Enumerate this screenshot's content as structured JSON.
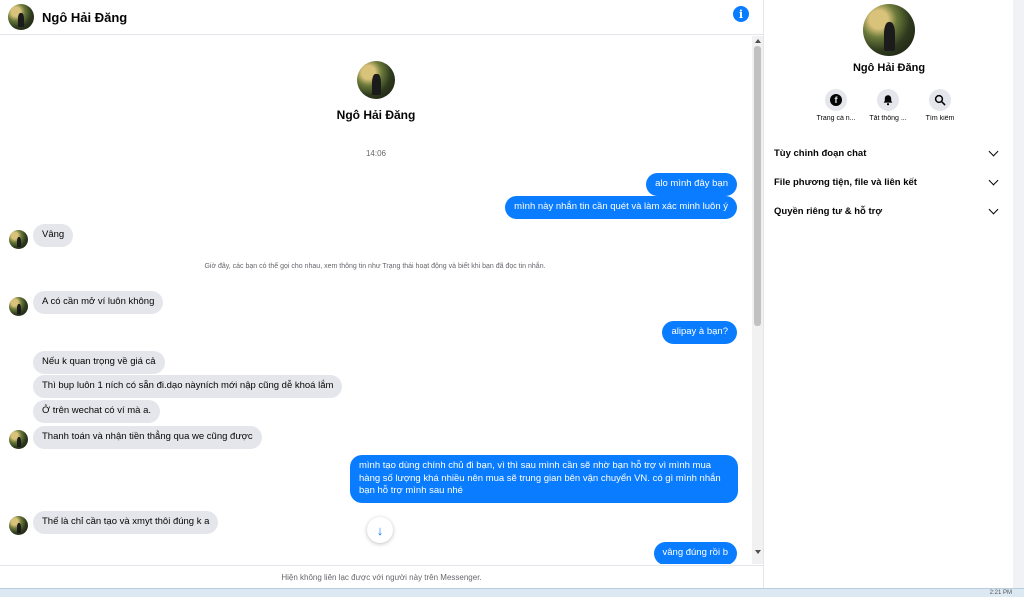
{
  "contact": {
    "name": "Ngô Hải Đăng"
  },
  "chat": {
    "timestamp": "14:06",
    "notice": "Giờ đây, các bạn có thể gọi cho nhau, xem thông tin như Trạng thái hoạt động và biết khi bạn đã đọc tin nhắn.",
    "footer": "Hiện không liên lạc được với người này trên Messenger.",
    "messages": [
      {
        "dir": "out",
        "text": "alo mình đây bạn"
      },
      {
        "dir": "out",
        "text": "mình này nhắn tin cần quét và làm xác minh luôn ý"
      },
      {
        "dir": "in",
        "text": "Vâng"
      },
      {
        "dir": "in",
        "text": "A có cần mở ví luôn không"
      },
      {
        "dir": "out",
        "text": "alipay à bạn?"
      },
      {
        "dir": "in",
        "text": "Nếu k quan trọng về giá cả"
      },
      {
        "dir": "in",
        "text": "Thì bụp luôn 1 ních có sẵn đi.dạo nàyních mới nập cũng dễ khoá lắm"
      },
      {
        "dir": "in",
        "text": "Ở trên wechat có ví mà a."
      },
      {
        "dir": "in",
        "text": "Thanh toán và nhận tiền thẳng qua we cũng được"
      },
      {
        "dir": "out",
        "text": "mình tạo dùng chính chủ đi bạn, vì thì sau mình cần sẽ nhờ bạn hỗ trợ vì mình mua hàng số lượng khá nhiều nên mua sẽ trung gian bên vận chuyển VN. có gì mình nhắn bạn hỗ trợ mình sau nhé"
      },
      {
        "dir": "in",
        "text": "Thế là chỉ cần tạo và xmyt thôi đúng k a"
      },
      {
        "dir": "out",
        "text": "vâng đúng rồi b"
      }
    ],
    "jump_icon": "arrow-down-icon"
  },
  "panel": {
    "actions": [
      {
        "label": "Trang cá n...",
        "icon": "facebook-icon"
      },
      {
        "label": "Tắt thông ...",
        "icon": "bell-icon"
      },
      {
        "label": "Tìm kiếm",
        "icon": "search-icon"
      }
    ],
    "sections": [
      {
        "label": "Tùy chỉnh đoạn chat"
      },
      {
        "label": "File phương tiện, file và liên kết"
      },
      {
        "label": "Quyền riêng tư & hỗ trợ"
      }
    ]
  },
  "taskbar": {
    "time": "2:21 PM"
  },
  "colors": {
    "outgoing": "#0a7cff",
    "incoming": "#e4e6eb",
    "accent": "#0a7cff"
  }
}
